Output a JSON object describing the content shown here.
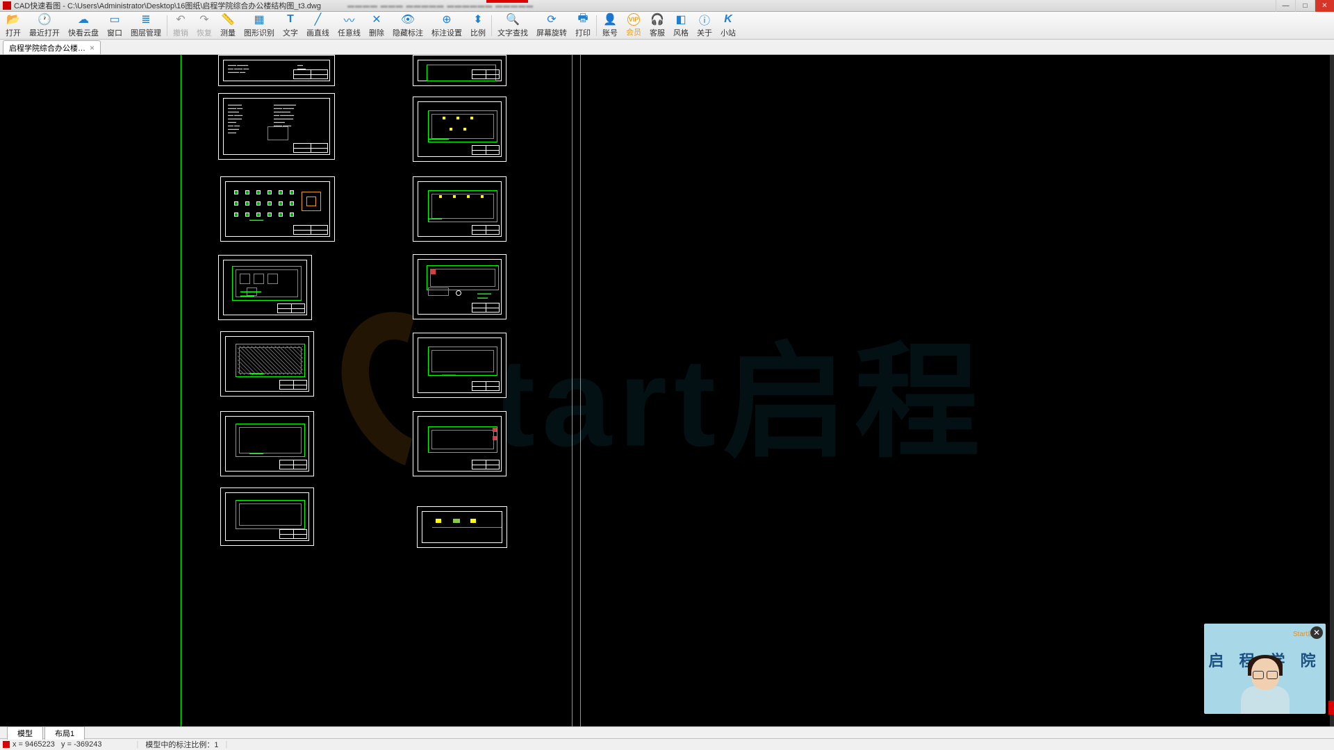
{
  "titlebar": {
    "app_name": "CAD快速看图",
    "file_path": "C:\\Users\\Administrator\\Desktop\\16图纸\\启程学院综合办公楼结构图_t3.dwg"
  },
  "toolbar": {
    "open": "打开",
    "recent_open": "最近打开",
    "quick_cloud": "快看云盘",
    "window": "窗口",
    "layer_mgmt": "图层管理",
    "undo": "撤销",
    "redo": "恢复",
    "measure": "测量",
    "shape_recog": "图形识别",
    "text": "文字",
    "draw_line": "画直线",
    "free_line": "任意线",
    "delete": "删除",
    "hide_annot": "隐藏标注",
    "annot_settings": "标注设置",
    "scale": "比例",
    "text_search": "文字查找",
    "screen_rotate": "屏幕旋转",
    "print": "打印",
    "account": "账号",
    "vip": "会员",
    "service": "客服",
    "style": "风格",
    "about": "关于",
    "station": "小站"
  },
  "doc_tab": {
    "name": "启程学院综合办公楼…"
  },
  "layout_tabs": {
    "model": "模型",
    "layout1": "布局1"
  },
  "status": {
    "coord_x_label": "x =",
    "coord_x_value": "9465223",
    "coord_y_label": "y =",
    "coord_y_value": "-369243",
    "annot_scale": "模型中的标注比例：1"
  },
  "video": {
    "logo": "Start启程",
    "title": "启 程 学 院"
  },
  "icons": {
    "open": "📂",
    "recent": "🕐",
    "cloud": "☁",
    "window": "▭",
    "layers": "≣",
    "undo": "↶",
    "redo": "↷",
    "measure": "📏",
    "recog": "▦",
    "text": "T",
    "line": "╱",
    "freeline": "〰",
    "delete": "✕",
    "hide": "👁",
    "settings": "⊕",
    "scale": "⬍",
    "search": "🔍",
    "rotate": "⟳",
    "print": "🖶",
    "account": "👤",
    "vip": "VIP",
    "service": "🎧",
    "style": "◧",
    "about": "ⓘ",
    "k": "K"
  },
  "colors": {
    "toolbar_blue": "#2080d0",
    "vip_orange": "#e8a020",
    "canvas_bg": "#000000",
    "drawing_green": "#00ff00",
    "drawing_white": "#ffffff"
  }
}
